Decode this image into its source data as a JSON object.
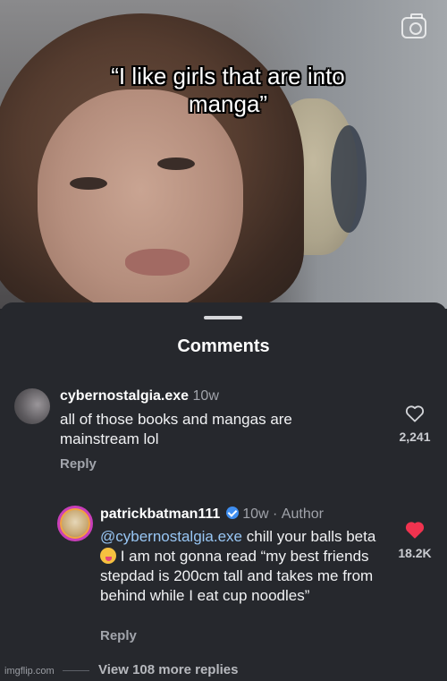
{
  "video": {
    "caption_line1": "“I like girls that are into",
    "caption_line2": "manga”",
    "camera_icon": "camera-icon"
  },
  "sheet": {
    "title": "Comments"
  },
  "comments": [
    {
      "username": "cybernostalgia.exe",
      "time": "10w",
      "text": "all of those books and mangas are mainstream lol",
      "reply_label": "Reply",
      "likes": "2,241",
      "liked": false
    }
  ],
  "replies": [
    {
      "username": "patrickbatman111",
      "verified": true,
      "time": "10w",
      "separator": "·",
      "author_label": "Author",
      "mention": "@cybernostalgia.exe",
      "text_part1": " chill your balls beta ",
      "emoji": "squinting-tongue-emoji",
      "text_part2": "I am not gonna read “my best friends stepdad is 200cm tall and takes me from behind while I eat cup noodles”",
      "reply_label": "Reply",
      "likes": "18.2K",
      "liked": true
    }
  ],
  "view_more": "View 108 more replies",
  "watermark": "imgflip.com",
  "colors": {
    "sheet_bg": "#26282d",
    "mention": "#98c6f4",
    "liked_heart": "#f0334f",
    "verified": "#3f8ef0"
  }
}
